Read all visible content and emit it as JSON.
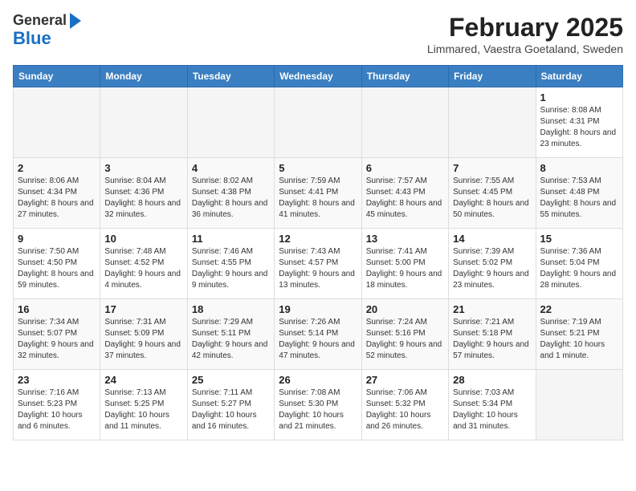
{
  "logo": {
    "general": "General",
    "blue": "Blue"
  },
  "title": {
    "month": "February 2025",
    "location": "Limmared, Vaestra Goetaland, Sweden"
  },
  "weekdays": [
    "Sunday",
    "Monday",
    "Tuesday",
    "Wednesday",
    "Thursday",
    "Friday",
    "Saturday"
  ],
  "weeks": [
    [
      {
        "day": "",
        "info": ""
      },
      {
        "day": "",
        "info": ""
      },
      {
        "day": "",
        "info": ""
      },
      {
        "day": "",
        "info": ""
      },
      {
        "day": "",
        "info": ""
      },
      {
        "day": "",
        "info": ""
      },
      {
        "day": "1",
        "info": "Sunrise: 8:08 AM\nSunset: 4:31 PM\nDaylight: 8 hours and 23 minutes."
      }
    ],
    [
      {
        "day": "2",
        "info": "Sunrise: 8:06 AM\nSunset: 4:34 PM\nDaylight: 8 hours and 27 minutes."
      },
      {
        "day": "3",
        "info": "Sunrise: 8:04 AM\nSunset: 4:36 PM\nDaylight: 8 hours and 32 minutes."
      },
      {
        "day": "4",
        "info": "Sunrise: 8:02 AM\nSunset: 4:38 PM\nDaylight: 8 hours and 36 minutes."
      },
      {
        "day": "5",
        "info": "Sunrise: 7:59 AM\nSunset: 4:41 PM\nDaylight: 8 hours and 41 minutes."
      },
      {
        "day": "6",
        "info": "Sunrise: 7:57 AM\nSunset: 4:43 PM\nDaylight: 8 hours and 45 minutes."
      },
      {
        "day": "7",
        "info": "Sunrise: 7:55 AM\nSunset: 4:45 PM\nDaylight: 8 hours and 50 minutes."
      },
      {
        "day": "8",
        "info": "Sunrise: 7:53 AM\nSunset: 4:48 PM\nDaylight: 8 hours and 55 minutes."
      }
    ],
    [
      {
        "day": "9",
        "info": "Sunrise: 7:50 AM\nSunset: 4:50 PM\nDaylight: 8 hours and 59 minutes."
      },
      {
        "day": "10",
        "info": "Sunrise: 7:48 AM\nSunset: 4:52 PM\nDaylight: 9 hours and 4 minutes."
      },
      {
        "day": "11",
        "info": "Sunrise: 7:46 AM\nSunset: 4:55 PM\nDaylight: 9 hours and 9 minutes."
      },
      {
        "day": "12",
        "info": "Sunrise: 7:43 AM\nSunset: 4:57 PM\nDaylight: 9 hours and 13 minutes."
      },
      {
        "day": "13",
        "info": "Sunrise: 7:41 AM\nSunset: 5:00 PM\nDaylight: 9 hours and 18 minutes."
      },
      {
        "day": "14",
        "info": "Sunrise: 7:39 AM\nSunset: 5:02 PM\nDaylight: 9 hours and 23 minutes."
      },
      {
        "day": "15",
        "info": "Sunrise: 7:36 AM\nSunset: 5:04 PM\nDaylight: 9 hours and 28 minutes."
      }
    ],
    [
      {
        "day": "16",
        "info": "Sunrise: 7:34 AM\nSunset: 5:07 PM\nDaylight: 9 hours and 32 minutes."
      },
      {
        "day": "17",
        "info": "Sunrise: 7:31 AM\nSunset: 5:09 PM\nDaylight: 9 hours and 37 minutes."
      },
      {
        "day": "18",
        "info": "Sunrise: 7:29 AM\nSunset: 5:11 PM\nDaylight: 9 hours and 42 minutes."
      },
      {
        "day": "19",
        "info": "Sunrise: 7:26 AM\nSunset: 5:14 PM\nDaylight: 9 hours and 47 minutes."
      },
      {
        "day": "20",
        "info": "Sunrise: 7:24 AM\nSunset: 5:16 PM\nDaylight: 9 hours and 52 minutes."
      },
      {
        "day": "21",
        "info": "Sunrise: 7:21 AM\nSunset: 5:18 PM\nDaylight: 9 hours and 57 minutes."
      },
      {
        "day": "22",
        "info": "Sunrise: 7:19 AM\nSunset: 5:21 PM\nDaylight: 10 hours and 1 minute."
      }
    ],
    [
      {
        "day": "23",
        "info": "Sunrise: 7:16 AM\nSunset: 5:23 PM\nDaylight: 10 hours and 6 minutes."
      },
      {
        "day": "24",
        "info": "Sunrise: 7:13 AM\nSunset: 5:25 PM\nDaylight: 10 hours and 11 minutes."
      },
      {
        "day": "25",
        "info": "Sunrise: 7:11 AM\nSunset: 5:27 PM\nDaylight: 10 hours and 16 minutes."
      },
      {
        "day": "26",
        "info": "Sunrise: 7:08 AM\nSunset: 5:30 PM\nDaylight: 10 hours and 21 minutes."
      },
      {
        "day": "27",
        "info": "Sunrise: 7:06 AM\nSunset: 5:32 PM\nDaylight: 10 hours and 26 minutes."
      },
      {
        "day": "28",
        "info": "Sunrise: 7:03 AM\nSunset: 5:34 PM\nDaylight: 10 hours and 31 minutes."
      },
      {
        "day": "",
        "info": ""
      }
    ]
  ]
}
